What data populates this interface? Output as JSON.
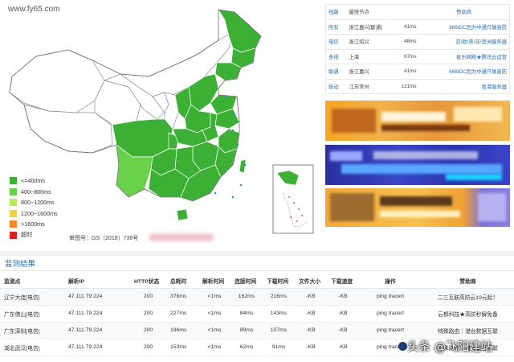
{
  "brand": "www.fy65.com",
  "legend": [
    {
      "label": "<=400ms",
      "color": "#3cb035"
    },
    {
      "label": "400~800ms",
      "color": "#6ad24a"
    },
    {
      "label": "800~1200ms",
      "color": "#b8e85d"
    },
    {
      "label": "1200~1600ms",
      "color": "#f0d44a"
    },
    {
      "label": ">1600ms",
      "color": "#f08a2a"
    },
    {
      "label": "超时",
      "color": "#d9231c"
    }
  ],
  "map_footnote": "审图号：GS（2018）738号",
  "fastest": {
    "headers": {
      "line": "线路",
      "node": "最快节点",
      "sponsor": "赞助商"
    },
    "rows": [
      {
        "line": "所有",
        "node": "浙江嘉兴[联通]",
        "time": "41ms",
        "sponsor": "666IDC因为中通只做高防"
      },
      {
        "line": "电信",
        "node": "浙江绍兴",
        "time": "48ms",
        "sponsor": "亚/欧/美/非/澳洲服务器"
      },
      {
        "line": "多线",
        "node": "上海",
        "time": "67ms",
        "sponsor": "星乐网络★腾讯云运营"
      },
      {
        "line": "联通",
        "node": "浙江嘉兴",
        "time": "41ms",
        "sponsor": "666IDC因为中通只做高防"
      },
      {
        "line": "移动",
        "node": "江苏常州",
        "time": "121ms",
        "sponsor": "香港服务器"
      }
    ]
  },
  "results": {
    "title": "监测结果",
    "headers": [
      "监测点",
      "解析IP",
      "HTTP状态",
      "总耗时",
      "解析时间",
      "连接时间",
      "下载时间",
      "文件大小",
      "下载速度",
      "操作",
      "赞助商"
    ],
    "rows": [
      {
        "point": "辽宁大连[电信]",
        "ip": "47.111.79.224",
        "status": "200",
        "total": "378ms",
        "resolve": "<1ms",
        "connect": "162ms",
        "download": "216ms",
        "size": "-KB",
        "speed": "-KB",
        "op": "ping tracert",
        "sponsor": "二三互联高防云19元起！"
      },
      {
        "point": "广东佛山[电信]",
        "ip": "47.111.79.224",
        "status": "200",
        "total": "227ms",
        "resolve": "<1ms",
        "connect": "84ms",
        "download": "143ms",
        "size": "-KB",
        "speed": "-KB",
        "op": "ping tracert",
        "sponsor": "云都科技★高防秒解免备"
      },
      {
        "point": "广东深圳[电信]",
        "ip": "47.111.79.224",
        "status": "200",
        "total": "196ms",
        "resolve": "<1ms",
        "connect": "89ms",
        "download": "107ms",
        "size": "-KB",
        "speed": "-KB",
        "op": "ping tracert",
        "sponsor": "特殊路由｜港台数据互联"
      },
      {
        "point": "湖北武汉[电信]",
        "ip": "47.111.79.224",
        "status": "200",
        "total": "153ms",
        "resolve": "<1ms",
        "connect": "62ms",
        "download": "91ms",
        "size": "-KB",
        "speed": "-KB",
        "op": "ping tracert",
        "sponsor": "特殊路由｜港台数据互联"
      }
    ]
  },
  "watermark": "头条 @飞阳建站"
}
